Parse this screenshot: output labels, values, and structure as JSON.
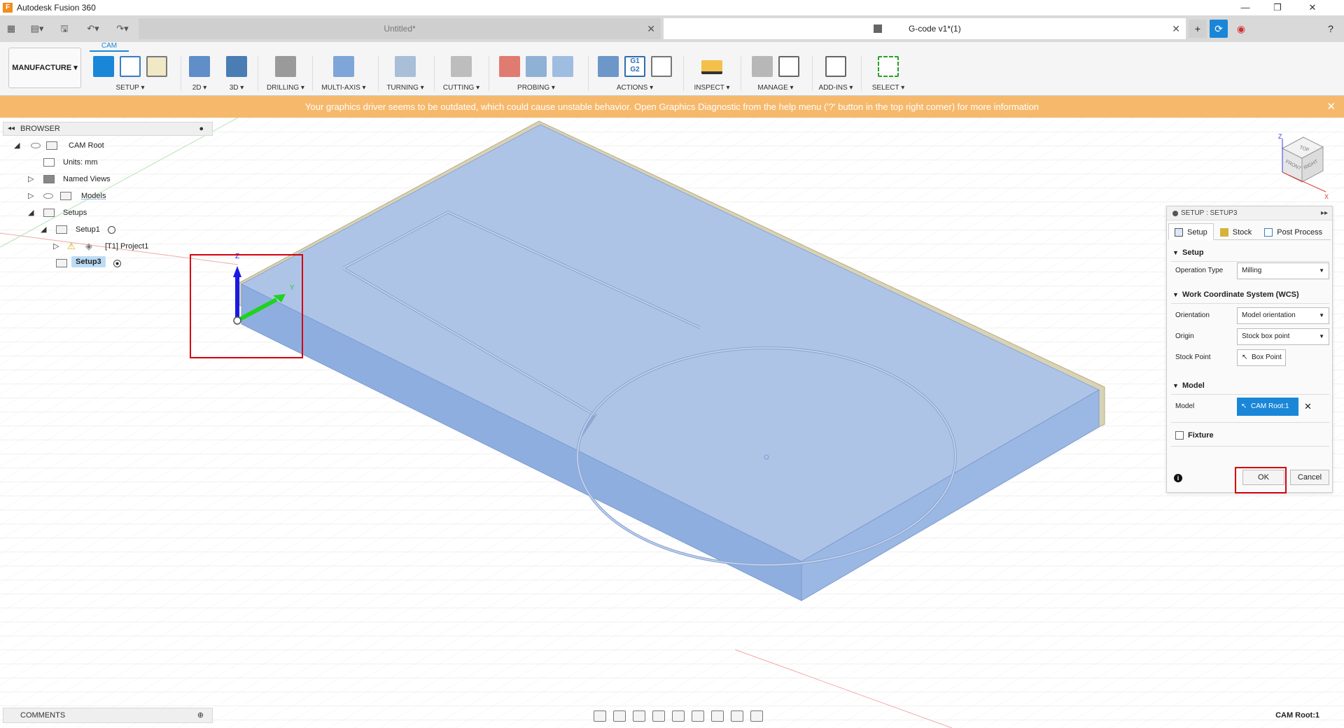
{
  "app": {
    "title": "Autodesk Fusion 360"
  },
  "tabs": [
    {
      "label": "Untitled*"
    },
    {
      "label": "G-code v1*(1)"
    }
  ],
  "ribbon": {
    "workspace": "MANUFACTURE ▾",
    "active_tab": "CAM",
    "groups": [
      {
        "label": "SETUP ▾"
      },
      {
        "label": "2D ▾"
      },
      {
        "label": "3D ▾"
      },
      {
        "label": "DRILLING ▾"
      },
      {
        "label": "MULTI-AXIS ▾"
      },
      {
        "label": "TURNING ▾"
      },
      {
        "label": "CUTTING ▾"
      },
      {
        "label": "PROBING ▾"
      },
      {
        "label": "ACTIONS ▾"
      },
      {
        "label": "INSPECT ▾"
      },
      {
        "label": "MANAGE ▾"
      },
      {
        "label": "ADD-INS ▾"
      },
      {
        "label": "SELECT ▾"
      }
    ]
  },
  "banner": {
    "message": "Your graphics driver seems to be outdated, which could cause unstable behavior. Open Graphics Diagnostic from the help menu ('?' button in the top right corner) for more information",
    "close": "✕"
  },
  "browser": {
    "title": "BROWSER",
    "items": [
      {
        "label": "CAM Root"
      },
      {
        "label": "Units: mm"
      },
      {
        "label": "Named Views"
      },
      {
        "label": "Models"
      },
      {
        "label": "Setups"
      },
      {
        "label": "Setup1"
      },
      {
        "label": "[T1] Project1"
      },
      {
        "label": "Setup3"
      }
    ]
  },
  "comments": {
    "title": "COMMENTS"
  },
  "status": {
    "text": "CAM Root:1"
  },
  "viewcube": {
    "top": "TOP",
    "front": "FRONT",
    "right": "RIGHT",
    "z": "Z",
    "x": "X"
  },
  "axes": {
    "z": "Z",
    "y": "Y"
  },
  "dialog": {
    "title": "SETUP : SETUP3",
    "tabs": [
      {
        "label": "Setup"
      },
      {
        "label": "Stock"
      },
      {
        "label": "Post Process"
      }
    ],
    "sections": {
      "setup": {
        "title": "Setup",
        "operation_type_label": "Operation Type",
        "operation_type_value": "Milling"
      },
      "wcs": {
        "title": "Work Coordinate System (WCS)",
        "orientation_label": "Orientation",
        "orientation_value": "Model orientation",
        "origin_label": "Origin",
        "origin_value": "Stock box point",
        "stock_point_label": "Stock Point",
        "stock_point_value": "Box Point"
      },
      "model": {
        "title": "Model",
        "model_label": "Model",
        "model_value": "CAM Root:1"
      },
      "fixture": {
        "title": "Fixture"
      }
    },
    "ok": "OK",
    "cancel": "Cancel"
  },
  "colors": {
    "accent": "#1a86d8",
    "banner": "#f6b96c",
    "annotation": "#d4000f",
    "part": "#aac2ec"
  }
}
